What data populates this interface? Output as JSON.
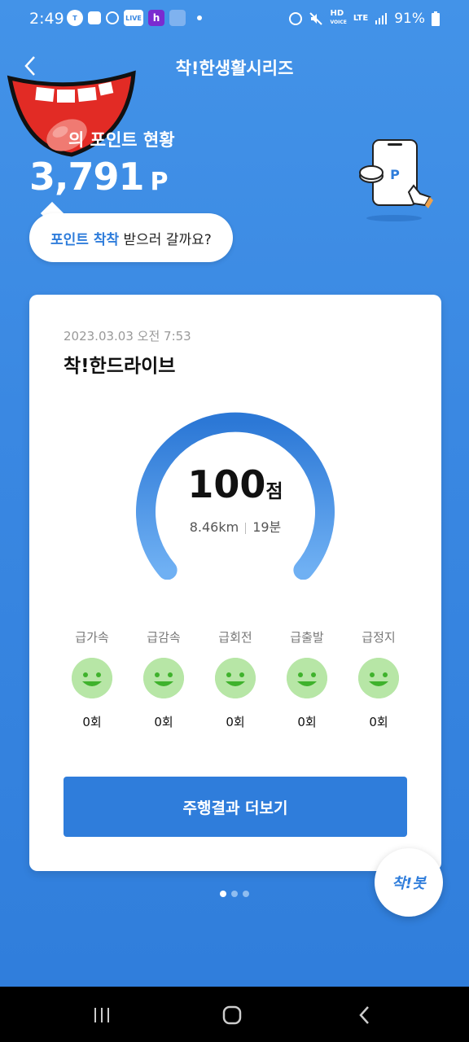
{
  "status_bar": {
    "time": "2:49",
    "icons_left": [
      "talk-icon",
      "grid-icon",
      "alarm-icon",
      "live-icon",
      "h-app-icon",
      "image-icon"
    ],
    "icons_right": [
      "alarm-icon",
      "mute-icon",
      "hd-voice-icon",
      "lte-icon",
      "signal-icon",
      "battery-icon"
    ],
    "battery": "91%"
  },
  "header": {
    "title": "착!한생활시리즈"
  },
  "points": {
    "label": "의 포인트 현황",
    "value": "3,791",
    "unit": "P",
    "phone_badge": "P"
  },
  "bubble": {
    "highlight": "포인트 착착",
    "rest": " 받으러 갈까요?"
  },
  "card": {
    "date": "2023.03.03 오전 7:53",
    "title": "착!한드라이브",
    "score": "100",
    "score_unit": "점",
    "score_value": 100,
    "distance": "8.46km",
    "duration": "19분",
    "events": [
      {
        "label": "급가속",
        "count": "0회"
      },
      {
        "label": "급감속",
        "count": "0회"
      },
      {
        "label": "급회전",
        "count": "0회"
      },
      {
        "label": "급출발",
        "count": "0회"
      },
      {
        "label": "급정지",
        "count": "0회"
      }
    ],
    "more_button": "주행결과 더보기"
  },
  "fab": {
    "label": "착!봇"
  },
  "pager": {
    "total": 3,
    "active": 1
  },
  "colors": {
    "accent": "#2f7ddb",
    "smile_bg": "#b7e6a6",
    "smile_fg": "#3fb22c"
  }
}
